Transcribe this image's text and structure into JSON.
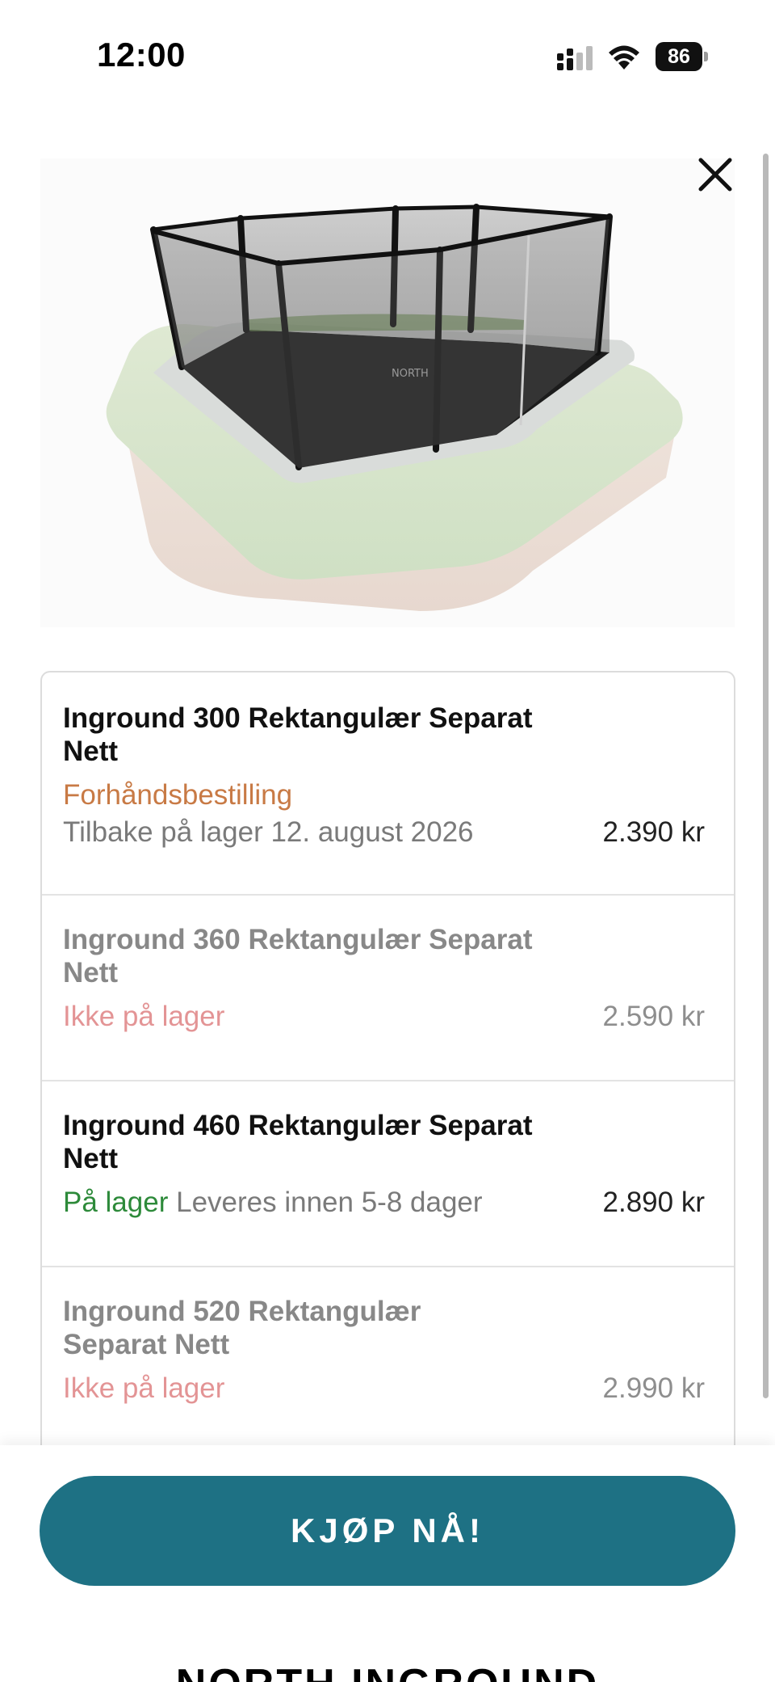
{
  "status_bar": {
    "time": "12:00",
    "battery_level": "86",
    "signal_icon": "cellular-signal-icon",
    "wifi_icon": "wifi-icon",
    "battery_icon": "battery-icon"
  },
  "product": {
    "image_alt": "NORTH inground trampoline with rectangular safety net",
    "net_logo_text": "NORTH"
  },
  "close_icon": "close-icon",
  "variants": [
    {
      "name": "Inground 300 Rektangulær Separat Nett",
      "status": "Forhåndsbestilling",
      "restock": "Tilbake på lager 12. august 2026",
      "price": "2.390 kr",
      "available": true
    },
    {
      "name": "Inground 360 Rektangulær Separat Nett",
      "status": "Ikke på lager",
      "price": "2.590 kr",
      "available": false
    },
    {
      "name": "Inground 460 Rektangulær Separat Nett",
      "status": "På lager",
      "delivery": "Leveres innen 5-8 dager",
      "price": "2.890 kr",
      "available": true
    },
    {
      "name": "Inground 520 Rektangulær Separat Nett",
      "status": "Ikke på lager",
      "price": "2.990 kr",
      "available": false
    }
  ],
  "buy_button_label": "KJØP NÅ!",
  "next_section_heading": "NORTH INGROUND",
  "colors": {
    "accent": "#1e7184",
    "preorder": "#c87a45",
    "in_stock": "#2d8a3a",
    "out_of_stock": "#e39495"
  }
}
